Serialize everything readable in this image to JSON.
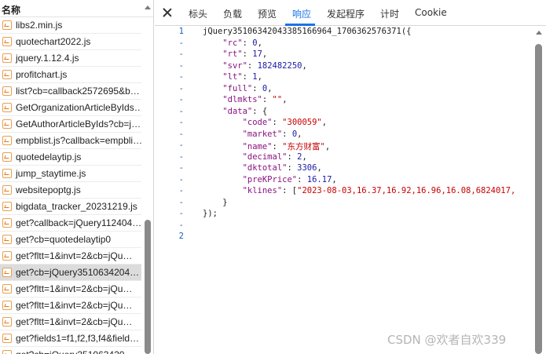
{
  "list": {
    "header": "名称",
    "items": [
      {
        "name": "libs2.min.js",
        "icon": "script-file-icon"
      },
      {
        "name": "quotechart2022.js",
        "icon": "script-file-icon"
      },
      {
        "name": "jquery.1.12.4.js",
        "icon": "script-file-icon"
      },
      {
        "name": "profitchart.js",
        "icon": "script-file-icon"
      },
      {
        "name": "list?cb=callback2572695&b…",
        "icon": "script-file-icon"
      },
      {
        "name": "GetOrganizationArticleByIds…",
        "icon": "script-file-icon"
      },
      {
        "name": "GetAuthorArticleByIds?cb=j…",
        "icon": "script-file-icon"
      },
      {
        "name": "empblist.js?callback=empbli…",
        "icon": "script-file-icon"
      },
      {
        "name": "quotedelaytip.js",
        "icon": "script-file-icon"
      },
      {
        "name": "jump_staytime.js",
        "icon": "script-file-icon"
      },
      {
        "name": "websitepoptg.js",
        "icon": "script-file-icon"
      },
      {
        "name": "bigdata_tracker_20231219.js",
        "icon": "script-file-icon"
      },
      {
        "name": "get?callback=jQuery112404…",
        "icon": "script-file-icon"
      },
      {
        "name": "get?cb=quotedelaytip0",
        "icon": "script-file-icon"
      },
      {
        "name": "get?fltt=1&invt=2&cb=jQu…",
        "icon": "script-file-icon"
      },
      {
        "name": "get?cb=jQuery3510634204…",
        "icon": "script-file-icon",
        "selected": true
      },
      {
        "name": "get?fltt=1&invt=2&cb=jQu…",
        "icon": "script-file-icon"
      },
      {
        "name": "get?fltt=1&invt=2&cb=jQu…",
        "icon": "script-file-icon"
      },
      {
        "name": "get?fltt=1&invt=2&cb=jQu…",
        "icon": "script-file-icon"
      },
      {
        "name": "get?fields1=f1,f2,f3,f4&field…",
        "icon": "script-file-icon"
      },
      {
        "name": "get?cb=jQuery351063420…",
        "icon": "script-file-icon"
      }
    ]
  },
  "tabs": {
    "close_icon": "close-icon",
    "items": [
      "标头",
      "负载",
      "预览",
      "响应",
      "发起程序",
      "计时",
      "Cookie"
    ],
    "active": "响应",
    "active_color": "#1a73e8"
  },
  "response": {
    "gutter": [
      "1",
      "-",
      "-",
      "-",
      "-",
      "-",
      "-",
      "-",
      "-",
      "-",
      "-",
      "-",
      "-",
      "-",
      "-",
      "-",
      "-",
      "-",
      "2"
    ],
    "lines": [
      "jQuery35106342043385166964_1706362576371({",
      "    \"rc\": 0,",
      "    \"rt\": 17,",
      "    \"svr\": 182482250,",
      "    \"lt\": 1,",
      "    \"full\": 0,",
      "    \"dlmkts\": \"\",",
      "    \"data\": {",
      "        \"code\": \"300059\",",
      "        \"market\": 0,",
      "        \"name\": \"东方财富\",",
      "        \"decimal\": 2,",
      "        \"dktotal\": 3306,",
      "        \"preKPrice\": 16.17,",
      "        \"klines\": [\"2023-08-03,16.37,16.92,16.96,16.08,6824017,",
      "    }",
      "});",
      ""
    ]
  },
  "watermark": "CSDN @欢者自欢339",
  "colors": {
    "line_number": "#1a5fb4",
    "json_key": "#881280",
    "json_string": "#c80000",
    "json_number": "#1a1aa6",
    "selected_row": "#dcdcdc"
  }
}
